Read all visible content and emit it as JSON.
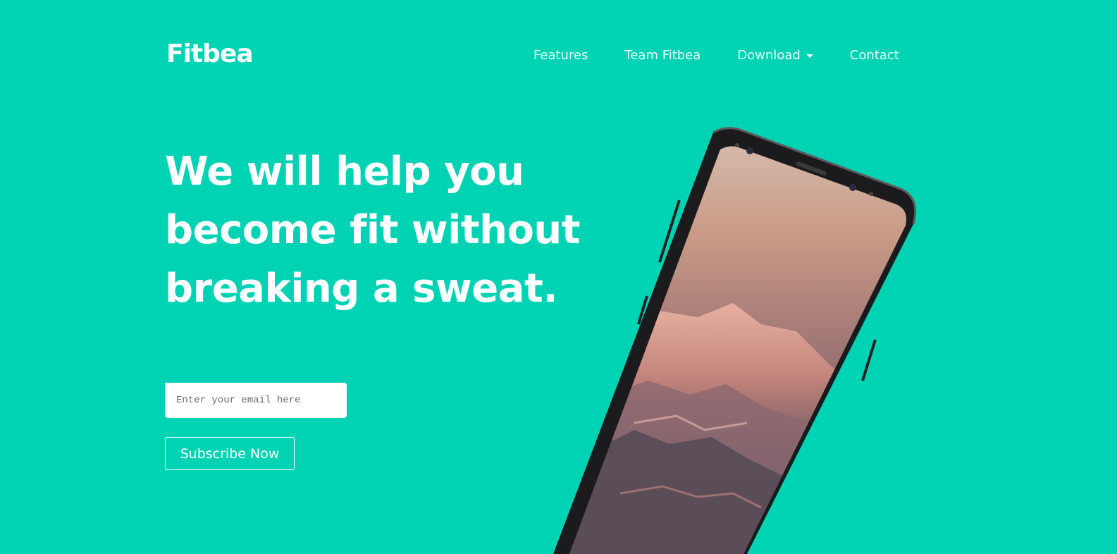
{
  "nav": {
    "brand": "Fitbea",
    "links": [
      {
        "label": "Features"
      },
      {
        "label": "Team Fitbea"
      },
      {
        "label": "Download"
      },
      {
        "label": "Contact"
      }
    ]
  },
  "hero": {
    "headline": "We will help you become fit without breaking a sweat.",
    "email_placeholder": "Enter your email here",
    "subscribe_label": "Subscribe Now"
  },
  "colors": {
    "background": "#00d3b4",
    "text": "#ffffff"
  }
}
